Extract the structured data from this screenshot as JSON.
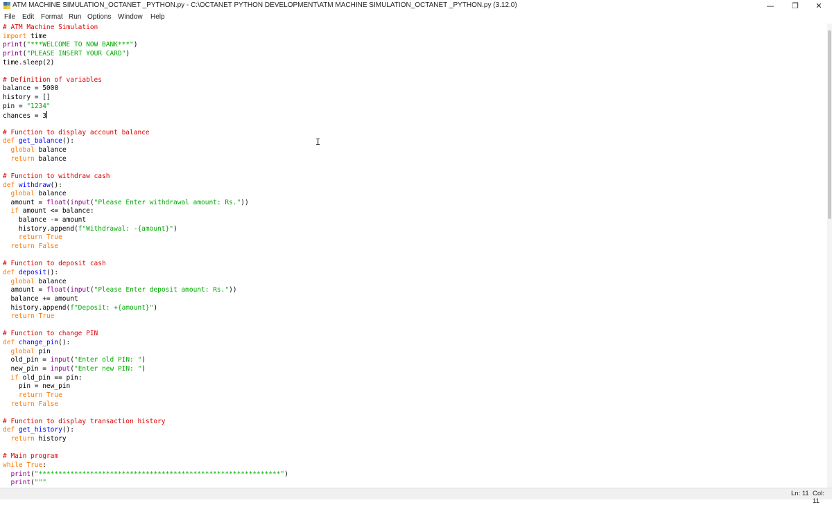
{
  "window": {
    "title": "ATM MACHINE SIMULATION_OCTANET _PYTHON.py - C:\\OCTANET PYTHON DEVELOPMENT\\ATM MACHINE SIMULATION_OCTANET _PYTHON.py (3.12.0)",
    "minimize_glyph": "—",
    "maximize_glyph": "❐",
    "close_glyph": "✕"
  },
  "menu": [
    "File",
    "Edit",
    "Format",
    "Run",
    "Options",
    "Window",
    "Help"
  ],
  "syntax_colors": {
    "comment": "#dd0000",
    "keyword": "#ff7700",
    "string": "#00aa00",
    "builtin": "#900090",
    "definition": "#0000ff"
  },
  "code_lines": [
    [
      {
        "t": "# ATM Machine Simulation",
        "c": "cm"
      }
    ],
    [
      {
        "t": "import",
        "c": "kw"
      },
      {
        "t": " time"
      }
    ],
    [
      {
        "t": "print",
        "c": "bi"
      },
      {
        "t": "("
      },
      {
        "t": "\"***WELCOME TO NOW BANK***\"",
        "c": "st"
      },
      {
        "t": ")"
      }
    ],
    [
      {
        "t": "print",
        "c": "bi"
      },
      {
        "t": "("
      },
      {
        "t": "\"PLEASE INSERT YOUR CARD\"",
        "c": "st"
      },
      {
        "t": ")"
      }
    ],
    [
      {
        "t": "time.sleep(2)"
      }
    ],
    [],
    [
      {
        "t": "# Definition of variables",
        "c": "cm"
      }
    ],
    [
      {
        "t": "balance = 5000"
      }
    ],
    [
      {
        "t": "history = []"
      }
    ],
    [
      {
        "t": "pin = "
      },
      {
        "t": "\"1234\"",
        "c": "st"
      }
    ],
    [
      {
        "t": "chances = 3"
      },
      {
        "cursor": true
      }
    ],
    [],
    [
      {
        "t": "# Function to display account balance",
        "c": "cm"
      }
    ],
    [
      {
        "t": "def",
        "c": "kw"
      },
      {
        "t": " "
      },
      {
        "t": "get_balance",
        "c": "df"
      },
      {
        "t": "():"
      }
    ],
    [
      {
        "t": "  "
      },
      {
        "t": "global",
        "c": "kw"
      },
      {
        "t": " balance"
      }
    ],
    [
      {
        "t": "  "
      },
      {
        "t": "return",
        "c": "kw"
      },
      {
        "t": " balance"
      }
    ],
    [],
    [
      {
        "t": "# Function to withdraw cash",
        "c": "cm"
      }
    ],
    [
      {
        "t": "def",
        "c": "kw"
      },
      {
        "t": " "
      },
      {
        "t": "withdraw",
        "c": "df"
      },
      {
        "t": "():"
      }
    ],
    [
      {
        "t": "  "
      },
      {
        "t": "global",
        "c": "kw"
      },
      {
        "t": " balance"
      }
    ],
    [
      {
        "t": "  amount = "
      },
      {
        "t": "float",
        "c": "bi"
      },
      {
        "t": "("
      },
      {
        "t": "input",
        "c": "bi"
      },
      {
        "t": "("
      },
      {
        "t": "\"Please Enter withdrawal amount: Rs.\"",
        "c": "st"
      },
      {
        "t": "))"
      }
    ],
    [
      {
        "t": "  "
      },
      {
        "t": "if",
        "c": "kw"
      },
      {
        "t": " amount <= balance:"
      }
    ],
    [
      {
        "t": "    balance -= amount"
      }
    ],
    [
      {
        "t": "    history.append("
      },
      {
        "t": "f\"Withdrawal: -{amount}\"",
        "c": "st"
      },
      {
        "t": ")"
      }
    ],
    [
      {
        "t": "    "
      },
      {
        "t": "return",
        "c": "kw"
      },
      {
        "t": " "
      },
      {
        "t": "True",
        "c": "kw"
      }
    ],
    [
      {
        "t": "  "
      },
      {
        "t": "return",
        "c": "kw"
      },
      {
        "t": " "
      },
      {
        "t": "False",
        "c": "kw"
      }
    ],
    [],
    [
      {
        "t": "# Function to deposit cash",
        "c": "cm"
      }
    ],
    [
      {
        "t": "def",
        "c": "kw"
      },
      {
        "t": " "
      },
      {
        "t": "deposit",
        "c": "df"
      },
      {
        "t": "():"
      }
    ],
    [
      {
        "t": "  "
      },
      {
        "t": "global",
        "c": "kw"
      },
      {
        "t": " balance"
      }
    ],
    [
      {
        "t": "  amount = "
      },
      {
        "t": "float",
        "c": "bi"
      },
      {
        "t": "("
      },
      {
        "t": "input",
        "c": "bi"
      },
      {
        "t": "("
      },
      {
        "t": "\"Please Enter deposit amount: Rs.\"",
        "c": "st"
      },
      {
        "t": "))"
      }
    ],
    [
      {
        "t": "  balance += amount"
      }
    ],
    [
      {
        "t": "  history.append("
      },
      {
        "t": "f\"Deposit: +{amount}\"",
        "c": "st"
      },
      {
        "t": ")"
      }
    ],
    [
      {
        "t": "  "
      },
      {
        "t": "return",
        "c": "kw"
      },
      {
        "t": " "
      },
      {
        "t": "True",
        "c": "kw"
      }
    ],
    [],
    [
      {
        "t": "# Function to change PIN",
        "c": "cm"
      }
    ],
    [
      {
        "t": "def",
        "c": "kw"
      },
      {
        "t": " "
      },
      {
        "t": "change_pin",
        "c": "df"
      },
      {
        "t": "():"
      }
    ],
    [
      {
        "t": "  "
      },
      {
        "t": "global",
        "c": "kw"
      },
      {
        "t": " pin"
      }
    ],
    [
      {
        "t": "  old_pin = "
      },
      {
        "t": "input",
        "c": "bi"
      },
      {
        "t": "("
      },
      {
        "t": "\"Enter old PIN: \"",
        "c": "st"
      },
      {
        "t": ")"
      }
    ],
    [
      {
        "t": "  new_pin = "
      },
      {
        "t": "input",
        "c": "bi"
      },
      {
        "t": "("
      },
      {
        "t": "\"Enter new PIN: \"",
        "c": "st"
      },
      {
        "t": ")"
      }
    ],
    [
      {
        "t": "  "
      },
      {
        "t": "if",
        "c": "kw"
      },
      {
        "t": " old_pin == pin:"
      }
    ],
    [
      {
        "t": "    pin = new_pin"
      }
    ],
    [
      {
        "t": "    "
      },
      {
        "t": "return",
        "c": "kw"
      },
      {
        "t": " "
      },
      {
        "t": "True",
        "c": "kw"
      }
    ],
    [
      {
        "t": "  "
      },
      {
        "t": "return",
        "c": "kw"
      },
      {
        "t": " "
      },
      {
        "t": "False",
        "c": "kw"
      }
    ],
    [],
    [
      {
        "t": "# Function to display transaction history",
        "c": "cm"
      }
    ],
    [
      {
        "t": "def",
        "c": "kw"
      },
      {
        "t": " "
      },
      {
        "t": "get_history",
        "c": "df"
      },
      {
        "t": "():"
      }
    ],
    [
      {
        "t": "  "
      },
      {
        "t": "return",
        "c": "kw"
      },
      {
        "t": " history"
      }
    ],
    [],
    [
      {
        "t": "# Main program",
        "c": "cm"
      }
    ],
    [
      {
        "t": "while",
        "c": "kw"
      },
      {
        "t": " "
      },
      {
        "t": "True",
        "c": "kw"
      },
      {
        "t": ":"
      }
    ],
    [
      {
        "t": "  "
      },
      {
        "t": "print",
        "c": "bi"
      },
      {
        "t": "("
      },
      {
        "t": "\"*************************************************************\"",
        "c": "st"
      },
      {
        "t": ")"
      }
    ],
    [
      {
        "t": "  "
      },
      {
        "t": "print",
        "c": "bi"
      },
      {
        "t": "("
      },
      {
        "t": "\"\"\"",
        "c": "st"
      }
    ]
  ],
  "status": {
    "line": "Ln: 11",
    "col": "Col: 11"
  }
}
